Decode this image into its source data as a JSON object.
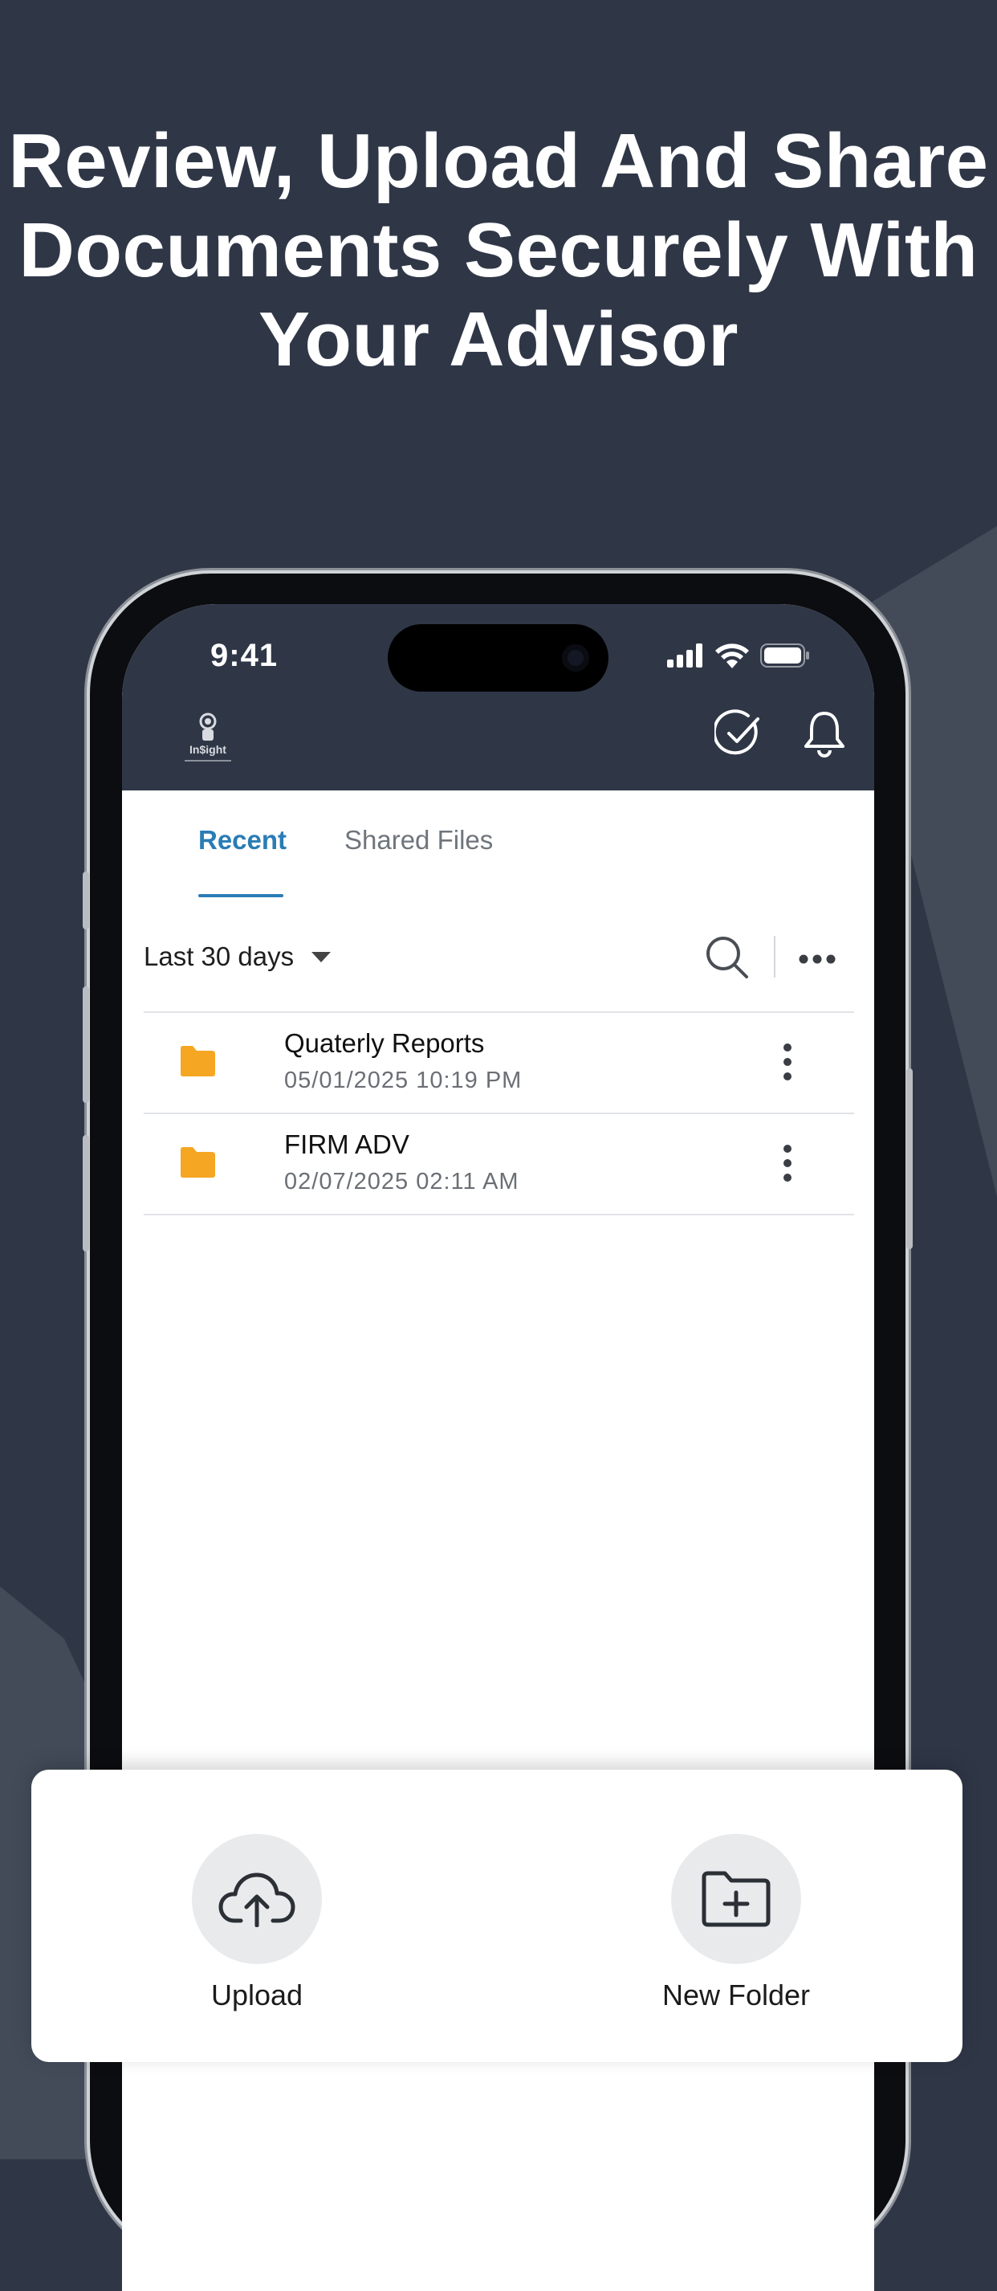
{
  "headline": {
    "line1": "Review, Upload And Share",
    "line2": "Documents Securely With",
    "line3": "Your Advisor"
  },
  "status_bar": {
    "time": "9:41"
  },
  "app_header": {
    "logo_text": "In$ight",
    "icons": [
      "logo-icon",
      "check-circle-icon",
      "bell-icon"
    ]
  },
  "tabs": {
    "recent": "Recent",
    "shared": "Shared Files"
  },
  "filter": {
    "label": "Last 30 days"
  },
  "files": [
    {
      "name": "Quaterly Reports",
      "date": "05/01/2025 10:19 PM"
    },
    {
      "name": "FIRM ADV",
      "date": "02/07/2025 02:11 AM"
    }
  ],
  "actions": {
    "upload": "Upload",
    "new_folder": "New Folder"
  },
  "colors": {
    "background": "#2f3747",
    "accent": "#2a7cb5",
    "folder": "#f5a623"
  }
}
